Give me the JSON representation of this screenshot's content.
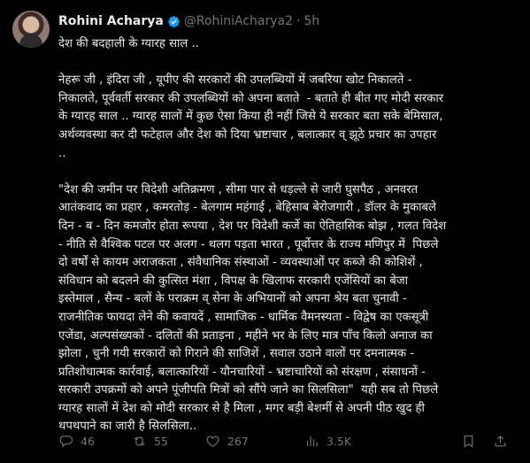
{
  "author": {
    "name": "Rohini Acharya",
    "handle": "@RohiniAcharya2",
    "separator": "·",
    "time": "5h"
  },
  "tweet": {
    "text": "देश की बदहाली के ग्यारह साल ..\n\nनेहरू जी , इंदिरा जी , यूपीए की सरकारों की उपलब्धियों में जबरिया खोट निकालते -\nनिकालते, पूर्ववर्ती सरकार की उपलब्धियों को अपना बताते  - बताते ही बीत गए मोदी सरकार\nके ग्यारह साल .. ग्यारह सालों में कुछ ऐसा किया ही नहीं जिसे ये सरकार बता सके बेमिसाल,\nअर्थव्यवस्था कर दी फटेहाल और देश को दिया भ्रष्टाचार , बलात्कार व् झूठे प्रचार का उपहार\n..\n\n\"देश की जमीन पर विदेशी अतिक्रमण , सीमा पार से धड़ल्ले से जारी घुसपैठ , अनवरत\nआतंकवाद का प्रहार , कमरतोड़ - बेलगाम महंगाई , बेहिसाब बेरोजगारी , डॉलर के मुकाबले\nदिन - ब - दिन कमजोर होता रूपया , देश पर विदेशी कर्जे का ऐतिहासिक बोझ , गलत विदेश\n- नीति से वैश्विक पटल पर अलग - थलग पड़ता भारत , पूर्वोत्तर के राज्य मणिपुर में  पिछले\nदो वर्षों से कायम अराजकता , संवैधानिक संस्थाओं - व्यवस्थाओं पर कब्जे की कोशिशें ,\nसंविधान को बदलने की कुत्सित मंशा , विपक्ष के खिलाफ सरकारी एजेंसियों का बेजा\nइस्तेमाल , सैन्य - बलों के पराक्रम व् सेना के अभियानों को अपना श्रेय बता चुनावी -\nराजनीतिक फायदा लेने की कवायदें , सामाजिक - धार्मिक वैमनस्यता - विद्वेष का एकसूत्री\nएजेंडा, अल्पसंख्यकों - दलितों की प्रताड़ना , महीने भर के लिए मात्र पाँच किलो अनाज का\nझोला , चुनी गयी सरकारों को गिराने की साजिशें , सवाल उठाने वालों पर दमनात्मक -\nप्रतिशोधात्मक कार्रवाई, बलात्कारियों - यौनचारियों - भ्रष्टाचारियों को संरक्षण , संसाधनों -\nसरकारी उपक्रमों को अपने पूंजीपति मित्रों को सौंपे जाने का सिलसिला\"  यही सब तो पिछले\nग्यारह सालों में देश को मोदी सरकार से है मिला , मगर बड़ी बेशर्मी से अपनी पीठ खुद ही\nथपथपाने का जारी है सिलसिला.."
  },
  "actions": {
    "replies": "46",
    "reposts": "55",
    "likes": "267",
    "views": "3.5K"
  },
  "icons": {
    "verified": "verified-badge-icon",
    "reply": "reply-icon",
    "repost": "retweet-icon",
    "like": "heart-icon",
    "views": "views-chart-icon",
    "bookmark": "bookmark-icon",
    "share": "share-icon"
  },
  "colors": {
    "background": "#000000",
    "text": "#e7e9ea",
    "secondary": "#71767b",
    "verified": "#1d9bf0"
  }
}
